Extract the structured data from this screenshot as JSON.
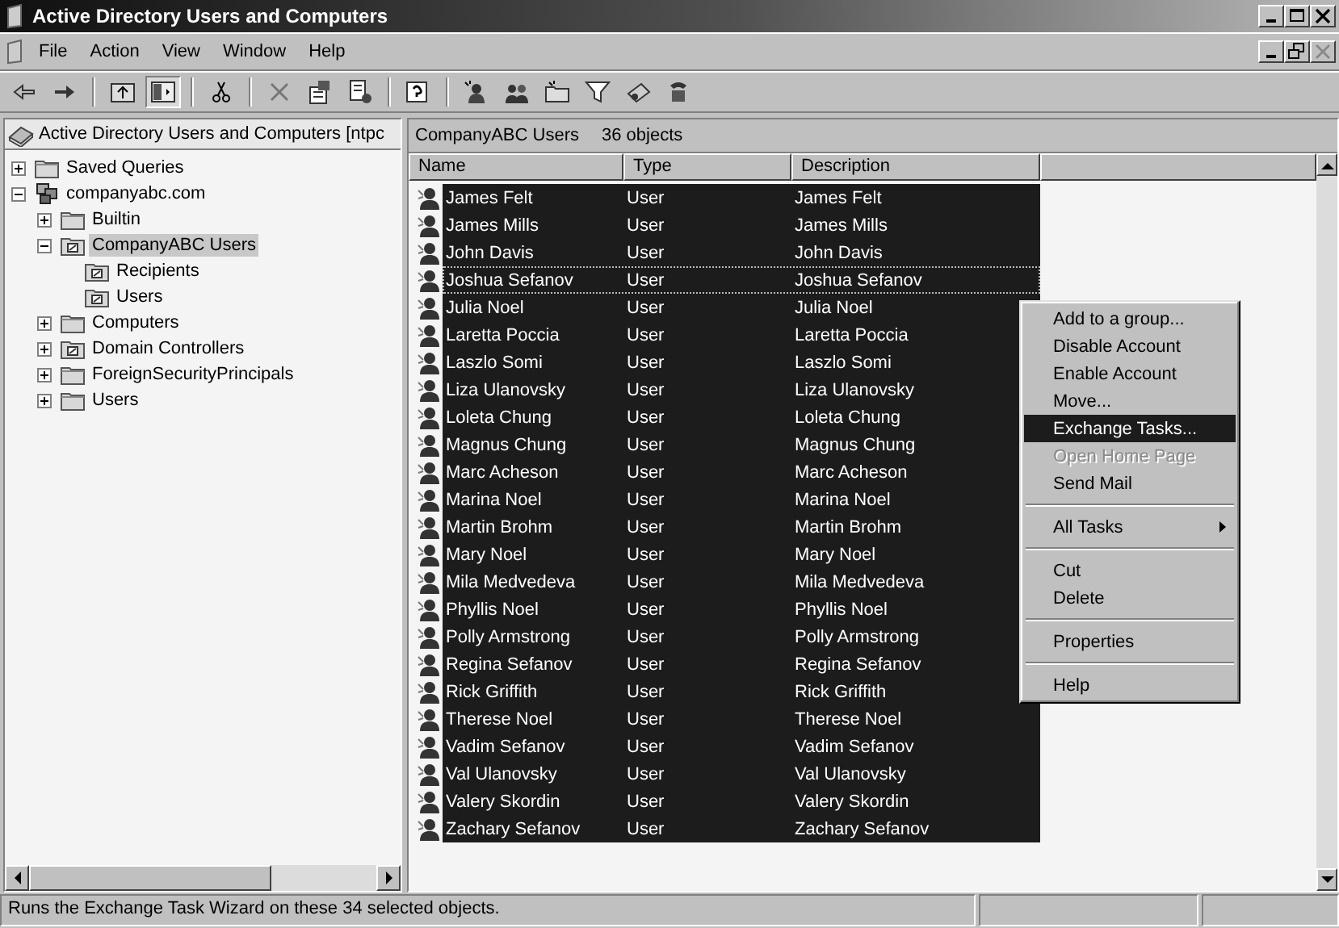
{
  "window": {
    "title": "Active Directory Users and Computers"
  },
  "menu_bar": [
    "File",
    "Action",
    "View",
    "Window",
    "Help"
  ],
  "tree": {
    "root": {
      "label": "Active Directory Users and Computers [ntpc",
      "kind": "console"
    },
    "items": [
      {
        "label": "Saved Queries",
        "kind": "folder",
        "expanded": false,
        "selected": false
      },
      {
        "label": "companyabc.com",
        "kind": "domain",
        "expanded": true,
        "selected": false,
        "children": [
          {
            "label": "Builtin",
            "kind": "folder",
            "expanded": false,
            "selected": false
          },
          {
            "label": "CompanyABC Users",
            "kind": "ou",
            "expanded": true,
            "selected": true,
            "children": [
              {
                "label": "Recipients",
                "kind": "ou",
                "selected": false
              },
              {
                "label": "Users",
                "kind": "ou",
                "selected": false
              }
            ]
          },
          {
            "label": "Computers",
            "kind": "folder",
            "expanded": false,
            "selected": false
          },
          {
            "label": "Domain Controllers",
            "kind": "ou",
            "expanded": false,
            "selected": false
          },
          {
            "label": "ForeignSecurityPrincipals",
            "kind": "folder",
            "expanded": false,
            "selected": false
          },
          {
            "label": "Users",
            "kind": "folder",
            "expanded": false,
            "selected": false
          }
        ]
      }
    ]
  },
  "list_header": {
    "title": "CompanyABC Users",
    "count": "36 objects"
  },
  "table": {
    "columns": [
      "Name",
      "Type",
      "Description"
    ],
    "rows": [
      {
        "name": "James Felt",
        "type": "User",
        "description": "James Felt",
        "selected": true,
        "focused": false
      },
      {
        "name": "James Mills",
        "type": "User",
        "description": "James Mills",
        "selected": true,
        "focused": false
      },
      {
        "name": "John Davis",
        "type": "User",
        "description": "John Davis",
        "selected": true,
        "focused": false
      },
      {
        "name": "Joshua Sefanov",
        "type": "User",
        "description": "Joshua Sefanov",
        "selected": true,
        "focused": true
      },
      {
        "name": "Julia Noel",
        "type": "User",
        "description": "Julia Noel",
        "selected": true,
        "focused": false
      },
      {
        "name": "Laretta Poccia",
        "type": "User",
        "description": "Laretta Poccia",
        "selected": true,
        "focused": false
      },
      {
        "name": "Laszlo Somi",
        "type": "User",
        "description": "Laszlo Somi",
        "selected": true,
        "focused": false
      },
      {
        "name": "Liza Ulanovsky",
        "type": "User",
        "description": "Liza Ulanovsky",
        "selected": true,
        "focused": false
      },
      {
        "name": "Loleta Chung",
        "type": "User",
        "description": "Loleta Chung",
        "selected": true,
        "focused": false
      },
      {
        "name": "Magnus Chung",
        "type": "User",
        "description": "Magnus Chung",
        "selected": true,
        "focused": false
      },
      {
        "name": "Marc Acheson",
        "type": "User",
        "description": "Marc Acheson",
        "selected": true,
        "focused": false
      },
      {
        "name": "Marina Noel",
        "type": "User",
        "description": "Marina Noel",
        "selected": true,
        "focused": false
      },
      {
        "name": "Martin Brohm",
        "type": "User",
        "description": "Martin Brohm",
        "selected": true,
        "focused": false
      },
      {
        "name": "Mary Noel",
        "type": "User",
        "description": "Mary Noel",
        "selected": true,
        "focused": false
      },
      {
        "name": "Mila Medvedeva",
        "type": "User",
        "description": "Mila Medvedeva",
        "selected": true,
        "focused": false
      },
      {
        "name": "Phyllis Noel",
        "type": "User",
        "description": "Phyllis Noel",
        "selected": true,
        "focused": false
      },
      {
        "name": "Polly Armstrong",
        "type": "User",
        "description": "Polly Armstrong",
        "selected": true,
        "focused": false
      },
      {
        "name": "Regina Sefanov",
        "type": "User",
        "description": "Regina Sefanov",
        "selected": true,
        "focused": false
      },
      {
        "name": "Rick Griffith",
        "type": "User",
        "description": "Rick Griffith",
        "selected": true,
        "focused": false
      },
      {
        "name": "Therese Noel",
        "type": "User",
        "description": "Therese Noel",
        "selected": true,
        "focused": false
      },
      {
        "name": "Vadim Sefanov",
        "type": "User",
        "description": "Vadim Sefanov",
        "selected": true,
        "focused": false
      },
      {
        "name": "Val Ulanovsky",
        "type": "User",
        "description": "Val Ulanovsky",
        "selected": true,
        "focused": false
      },
      {
        "name": "Valery Skordin",
        "type": "User",
        "description": "Valery Skordin",
        "selected": true,
        "focused": false
      },
      {
        "name": "Zachary Sefanov",
        "type": "User",
        "description": "Zachary Sefanov",
        "selected": true,
        "focused": false
      }
    ]
  },
  "context_menu": [
    {
      "kind": "item",
      "label": "Add to a group...",
      "disabled": false,
      "selected": false
    },
    {
      "kind": "item",
      "label": "Disable Account",
      "disabled": false,
      "selected": false
    },
    {
      "kind": "item",
      "label": "Enable Account",
      "disabled": false,
      "selected": false
    },
    {
      "kind": "item",
      "label": "Move...",
      "disabled": false,
      "selected": false
    },
    {
      "kind": "item",
      "label": "Exchange Tasks...",
      "disabled": false,
      "selected": true
    },
    {
      "kind": "item",
      "label": "Open Home Page",
      "disabled": true,
      "selected": false
    },
    {
      "kind": "item",
      "label": "Send Mail",
      "disabled": false,
      "selected": false
    },
    {
      "kind": "separator"
    },
    {
      "kind": "submenu",
      "label": "All Tasks",
      "disabled": false,
      "selected": false
    },
    {
      "kind": "separator"
    },
    {
      "kind": "item",
      "label": "Cut",
      "disabled": false,
      "selected": false
    },
    {
      "kind": "item",
      "label": "Delete",
      "disabled": false,
      "selected": false
    },
    {
      "kind": "separator"
    },
    {
      "kind": "item",
      "label": "Properties",
      "disabled": false,
      "selected": false
    },
    {
      "kind": "separator"
    },
    {
      "kind": "item",
      "label": "Help",
      "disabled": false,
      "selected": false
    }
  ],
  "status_bar": {
    "text": "Runs the Exchange Task Wizard on these 34 selected objects."
  }
}
